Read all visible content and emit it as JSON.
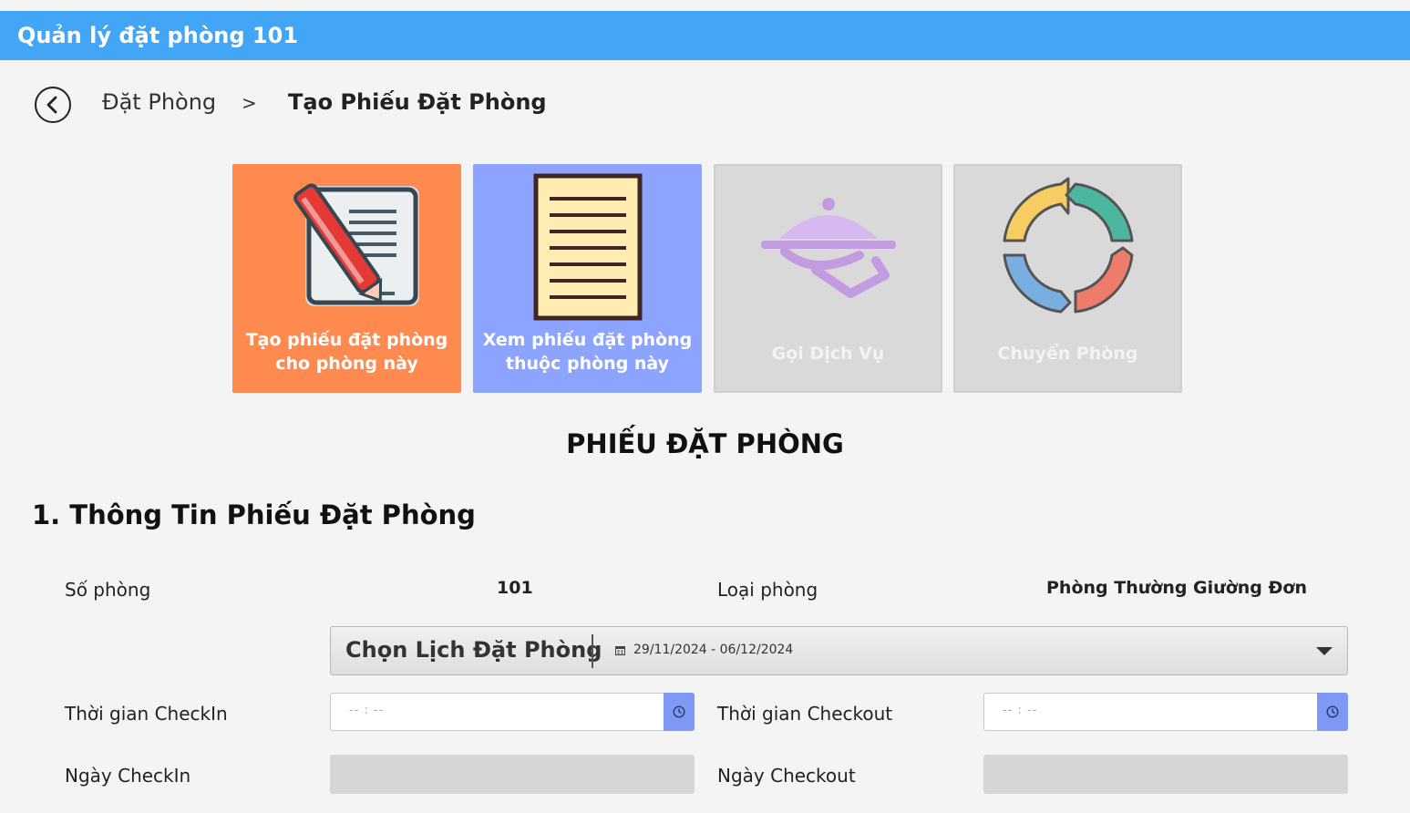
{
  "window": {
    "title": "Quản lý đặt phòng 101"
  },
  "breadcrumb": {
    "root": "Đặt Phòng",
    "separator": ">",
    "current": "Tạo Phiếu Đặt Phòng"
  },
  "tiles": [
    {
      "line1": "Tạo phiếu đặt phòng",
      "line2": "cho phòng này",
      "icon": "form-pen-icon",
      "color": "#ff8a50"
    },
    {
      "line1": "Xem phiếu đặt phòng",
      "line2": "thuộc phòng này",
      "icon": "document-list-icon",
      "color": "#8ca4ff"
    },
    {
      "line1": "Gọi Dịch Vụ",
      "icon": "room-service-icon",
      "color": "#d9d9d9"
    },
    {
      "line1": "Chuyển Phòng",
      "icon": "cycle-arrows-icon",
      "color": "#d9d9d9"
    }
  ],
  "form": {
    "title": "PHIẾU ĐẶT PHÒNG",
    "section1": "1. Thông Tin Phiếu Đặt Phòng",
    "room_number_label": "Số phòng",
    "room_number": "101",
    "room_type_label": "Loại phòng",
    "room_type": "Phòng Thường Giường Đơn",
    "date_picker": {
      "title": "Chọn Lịch Đặt Phòng",
      "range": "29/11/2024 - 06/12/2024"
    },
    "checkin_time_label": "Thời gian CheckIn",
    "checkin_time_placeholder": "--  :  --",
    "checkout_time_label": "Thời gian Checkout",
    "checkout_time_placeholder": "--  :  --",
    "checkin_date_label": "Ngày CheckIn",
    "checkout_date_label": "Ngày Checkout"
  }
}
